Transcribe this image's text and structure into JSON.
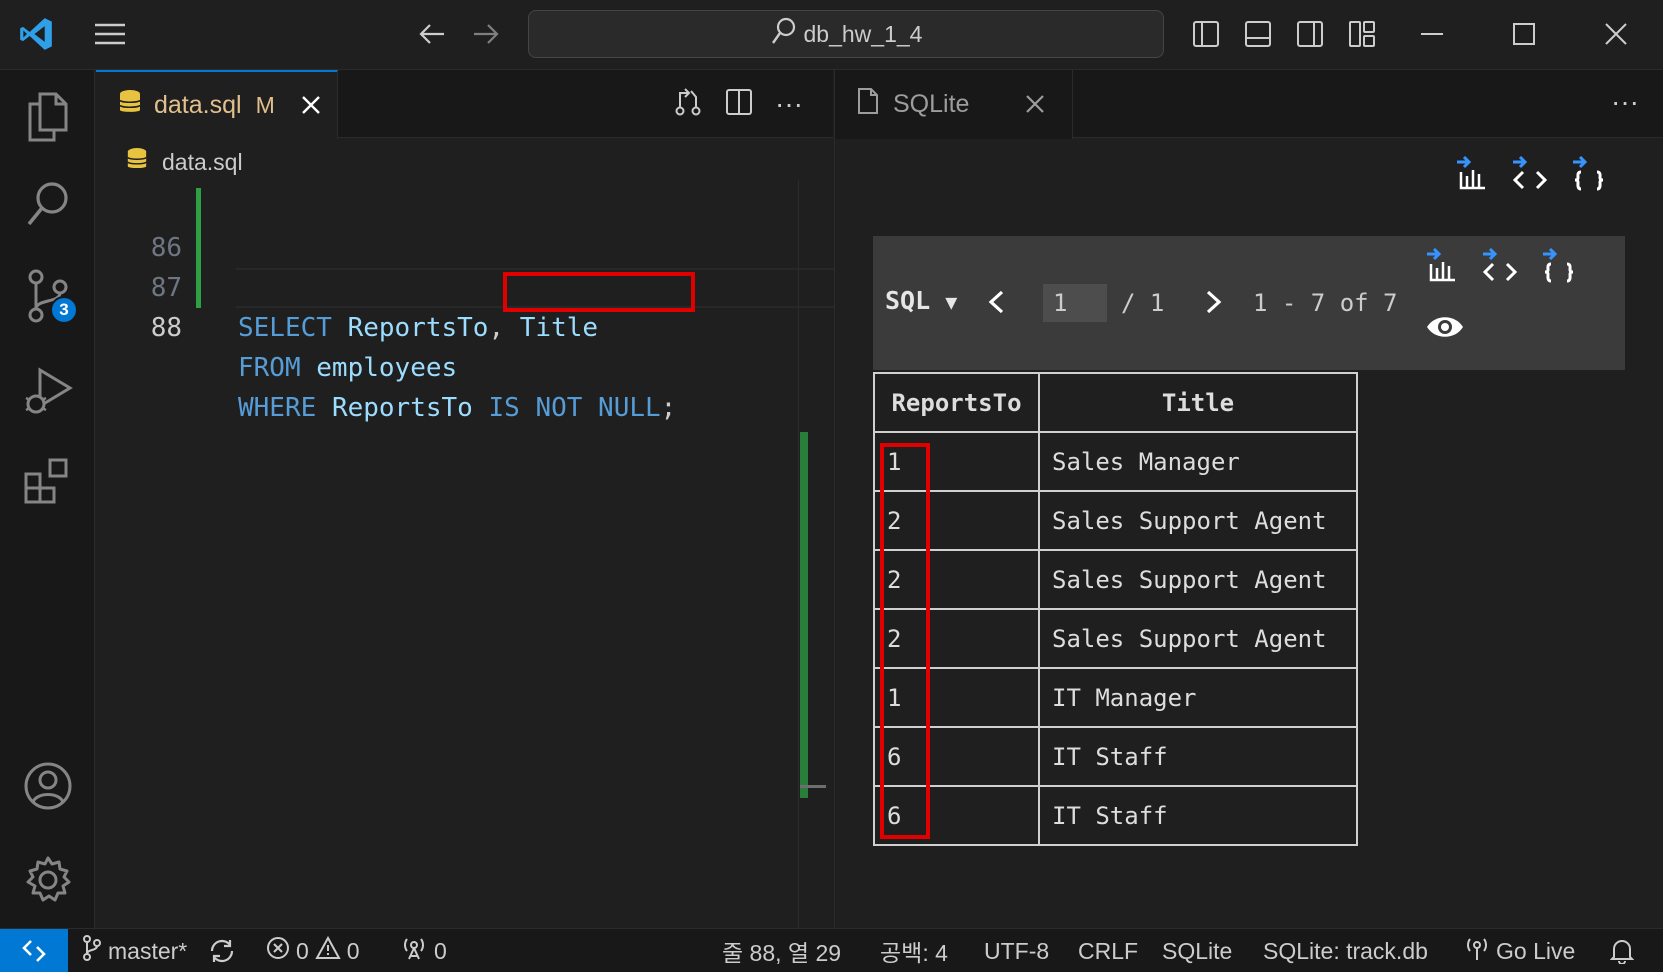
{
  "titlebar": {
    "search_text": "db_hw_1_4"
  },
  "activity": {
    "scm_badge": "3"
  },
  "editor": {
    "tab": {
      "name": "data.sql",
      "modified": "M"
    },
    "breadcrumb": "data.sql",
    "lines": [
      {
        "num": "86",
        "tokens": [
          "SELECT",
          "ReportsTo",
          ",",
          "Title"
        ]
      },
      {
        "num": "87",
        "tokens": [
          "FROM",
          "employees"
        ]
      },
      {
        "num": "88",
        "tokens": [
          "WHERE",
          "ReportsTo",
          "IS NOT NULL",
          ";"
        ]
      }
    ]
  },
  "panel": {
    "tab_name": "SQLite",
    "sql_label": "SQL",
    "dropdown_arrow": "▼",
    "page_value": "1",
    "page_total": "/ 1",
    "range_text": "1 - 7 of 7",
    "columns": [
      "ReportsTo",
      "Title"
    ],
    "rows": [
      [
        "1",
        "Sales Manager"
      ],
      [
        "2",
        "Sales Support Agent"
      ],
      [
        "2",
        "Sales Support Agent"
      ],
      [
        "2",
        "Sales Support Agent"
      ],
      [
        "1",
        "IT Manager"
      ],
      [
        "6",
        "IT Staff"
      ],
      [
        "6",
        "IT Staff"
      ]
    ]
  },
  "statusbar": {
    "branch": "master*",
    "errors": "0",
    "warnings": "0",
    "ports": "0",
    "cursor": "줄 88, 열 29",
    "spaces": "공백: 4",
    "encoding": "UTF-8",
    "eol": "CRLF",
    "language": "SQLite",
    "db": "SQLite: track.db",
    "golive": "Go Live"
  },
  "colors": {
    "accent": "#0078d4",
    "highlight": "#e00000",
    "git_added": "#2ea043"
  }
}
